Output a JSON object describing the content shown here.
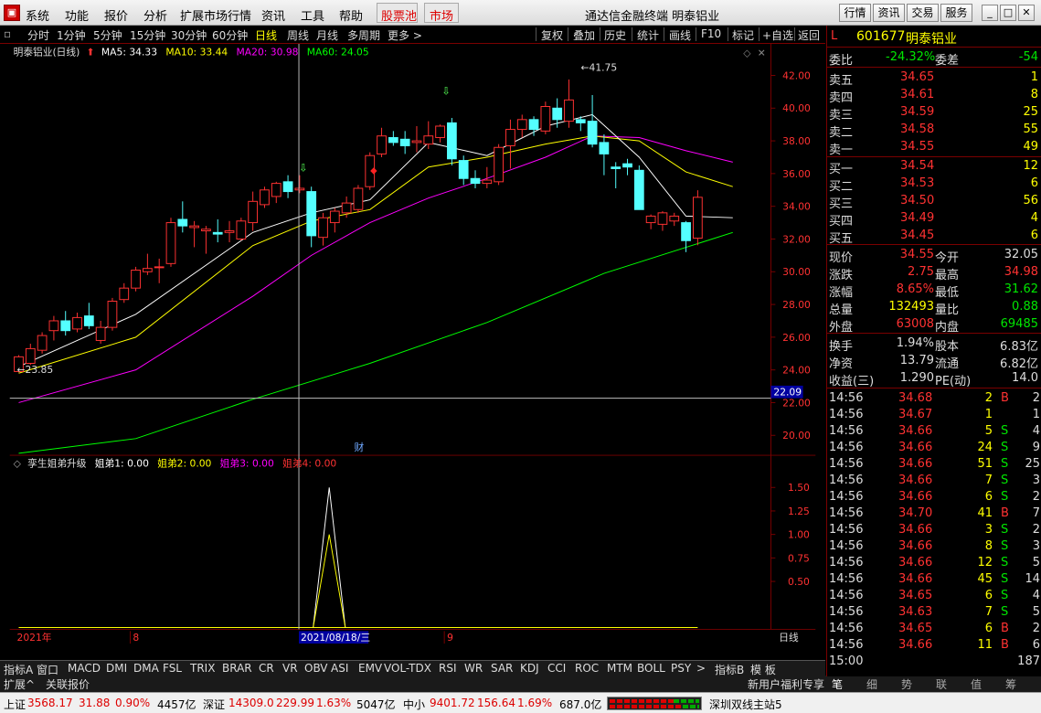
{
  "menubar": {
    "items": [
      "系统",
      "功能",
      "报价",
      "分析",
      "扩展市场行情",
      "资讯",
      "工具",
      "帮助"
    ],
    "red_items": [
      "股票池",
      "市场"
    ],
    "title": "通达信金融终端  明泰铝业",
    "right_buttons": [
      "行情",
      "资讯",
      "交易",
      "服务"
    ]
  },
  "toolbar": {
    "periods": [
      "分时",
      "1分钟",
      "5分钟",
      "15分钟",
      "30分钟",
      "60分钟",
      "日线",
      "周线",
      "月线",
      "多周期",
      "更多 >"
    ],
    "active": "日线",
    "actions": [
      "复权",
      "叠加",
      "历史",
      "统计",
      "画线",
      "F10",
      "标记",
      "+自选",
      "返回"
    ]
  },
  "chart": {
    "legend": {
      "name": "明泰铝业(日线)",
      "ma5": "MA5: 34.33",
      "ma10": "MA10: 33.44",
      "ma20": "MA20: 30.98",
      "ma60": "MA60: 24.05"
    },
    "high_label": "41.75",
    "low_label": "23.85",
    "crosshair_price": "22.09",
    "fin_marker": "财",
    "yticks": [
      "42.00",
      "40.00",
      "38.00",
      "36.00",
      "34.00",
      "32.00",
      "30.00",
      "28.00",
      "26.00",
      "24.00",
      "22.00",
      "20.00"
    ],
    "indicator_legend": {
      "name": "孪生姐弟升级",
      "s1": "姐弟1: 0.00",
      "s2": "姐弟2: 0.00",
      "s3": "姐弟3: 0.00",
      "s4": "姐弟4: 0.00"
    },
    "indicator_yticks": [
      "1.50",
      "1.00",
      "0.50"
    ],
    "indicator_extra_ticks": [
      "1.25",
      "0.75"
    ],
    "xaxis": {
      "year": "2021年",
      "m8": "8",
      "date": "2021/08/18/三",
      "m9": "9",
      "period": "日线"
    },
    "colors": {
      "up": "#ff3232",
      "down": "#54ffff",
      "ma5": "#ffffff",
      "ma10": "#ffff00",
      "ma20": "#ff00ff",
      "ma60": "#00ff00"
    }
  },
  "bottom_tabs": [
    "指标A",
    "窗口",
    "MACD",
    "DMI",
    "DMA",
    "FSL",
    "TRIX",
    "BRAR",
    "CR",
    "VR",
    "OBV",
    "ASI",
    "EMV",
    "VOL-TDX",
    "RSI",
    "WR",
    "SAR",
    "KDJ",
    "CCI",
    "ROC",
    "MTM",
    "BOLL",
    "PSY",
    ">",
    "指标B",
    "模 板"
  ],
  "ext_row": {
    "left": [
      "扩展^",
      "关联报价"
    ],
    "right": "新用户福利专享"
  },
  "right_tabs": [
    "笔",
    "细",
    "势",
    "联",
    "值",
    "筹"
  ],
  "quote": {
    "code": "601677",
    "name": "明泰铝业",
    "flag": "L",
    "weibi_label": "委比",
    "weibi": "-24.32%",
    "weicha_label": "委差",
    "weicha": "-54",
    "asks": [
      {
        "label": "卖五",
        "price": "34.65",
        "vol": "1"
      },
      {
        "label": "卖四",
        "price": "34.61",
        "vol": "8"
      },
      {
        "label": "卖三",
        "price": "34.59",
        "vol": "25"
      },
      {
        "label": "卖二",
        "price": "34.58",
        "vol": "55"
      },
      {
        "label": "卖一",
        "price": "34.55",
        "vol": "49"
      }
    ],
    "bids": [
      {
        "label": "买一",
        "price": "34.54",
        "vol": "12"
      },
      {
        "label": "买二",
        "price": "34.53",
        "vol": "6"
      },
      {
        "label": "买三",
        "price": "34.50",
        "vol": "56"
      },
      {
        "label": "买四",
        "price": "34.49",
        "vol": "4"
      },
      {
        "label": "买五",
        "price": "34.45",
        "vol": "6"
      }
    ],
    "stats": [
      {
        "l1": "现价",
        "v1": "34.55",
        "c1": "up",
        "l2": "今开",
        "v2": "32.05",
        "c2": "wh"
      },
      {
        "l1": "涨跌",
        "v1": "2.75",
        "c1": "up",
        "l2": "最高",
        "v2": "34.98",
        "c2": "up"
      },
      {
        "l1": "涨幅",
        "v1": "8.65%",
        "c1": "up",
        "l2": "最低",
        "v2": "31.62",
        "c2": "dn"
      },
      {
        "l1": "总量",
        "v1": "132493",
        "c1": "yl",
        "l2": "量比",
        "v2": "0.88",
        "c2": "dn"
      },
      {
        "l1": "外盘",
        "v1": "63008",
        "c1": "up",
        "l2": "内盘",
        "v2": "69485",
        "c2": "dn"
      }
    ],
    "stats2": [
      {
        "l1": "换手",
        "v1": "1.94%",
        "l2": "股本",
        "v2": "6.83亿"
      },
      {
        "l1": "净资",
        "v1": "13.79",
        "l2": "流通",
        "v2": "6.82亿"
      },
      {
        "l1": "收益(三)",
        "v1": "1.290",
        "l2": "PE(动)",
        "v2": "14.0"
      }
    ],
    "ticks": [
      {
        "t": "14:56",
        "p": "34.68",
        "v": "2",
        "bs": "B",
        "n": "2"
      },
      {
        "t": "14:56",
        "p": "34.67",
        "v": "1",
        "bs": "",
        "n": "1"
      },
      {
        "t": "14:56",
        "p": "34.66",
        "v": "5",
        "bs": "S",
        "n": "4"
      },
      {
        "t": "14:56",
        "p": "34.66",
        "v": "24",
        "bs": "S",
        "n": "9"
      },
      {
        "t": "14:56",
        "p": "34.66",
        "v": "51",
        "bs": "S",
        "n": "25"
      },
      {
        "t": "14:56",
        "p": "34.66",
        "v": "7",
        "bs": "S",
        "n": "3"
      },
      {
        "t": "14:56",
        "p": "34.66",
        "v": "6",
        "bs": "S",
        "n": "2"
      },
      {
        "t": "14:56",
        "p": "34.70",
        "v": "41",
        "bs": "B",
        "n": "7"
      },
      {
        "t": "14:56",
        "p": "34.66",
        "v": "3",
        "bs": "S",
        "n": "2"
      },
      {
        "t": "14:56",
        "p": "34.66",
        "v": "8",
        "bs": "S",
        "n": "3"
      },
      {
        "t": "14:56",
        "p": "34.66",
        "v": "12",
        "bs": "S",
        "n": "5"
      },
      {
        "t": "14:56",
        "p": "34.66",
        "v": "45",
        "bs": "S",
        "n": "14"
      },
      {
        "t": "14:56",
        "p": "34.65",
        "v": "6",
        "bs": "S",
        "n": "4"
      },
      {
        "t": "14:56",
        "p": "34.63",
        "v": "7",
        "bs": "S",
        "n": "5"
      },
      {
        "t": "14:56",
        "p": "34.65",
        "v": "6",
        "bs": "B",
        "n": "2"
      },
      {
        "t": "14:56",
        "p": "34.66",
        "v": "11",
        "bs": "B",
        "n": "6"
      },
      {
        "t": "15:00",
        "p": "",
        "v": "",
        "bs": "",
        "n": "187"
      }
    ]
  },
  "statusbar": {
    "sh_label": "上证",
    "sh_val": "3568.17",
    "sh_chg": "31.88",
    "sh_pct": "0.90%",
    "sh_amt": "4457亿",
    "sz_label": "深证",
    "sz_val": "14309.0",
    "sz_chg": "229.99",
    "sz_pct": "1.63%",
    "sz_amt": "5047亿",
    "zx_label": "中小",
    "zx_val": "9401.72",
    "zx_chg": "156.64",
    "zx_pct": "1.69%",
    "zx_amt": "687.0亿",
    "server": "深圳双线主站5"
  },
  "chart_data": {
    "type": "candlestick",
    "title": "明泰铝业(日线)",
    "ylim": [
      19,
      43
    ],
    "candles": [
      {
        "o": 23.9,
        "h": 24.9,
        "l": 23.85,
        "c": 24.8
      },
      {
        "o": 24.4,
        "h": 25.6,
        "l": 24.3,
        "c": 25.3
      },
      {
        "o": 25.2,
        "h": 26.3,
        "l": 25.0,
        "c": 26.1
      },
      {
        "o": 26.4,
        "h": 27.3,
        "l": 25.8,
        "c": 27.0
      },
      {
        "o": 27.0,
        "h": 27.6,
        "l": 26.1,
        "c": 26.4
      },
      {
        "o": 26.5,
        "h": 27.5,
        "l": 26.3,
        "c": 27.2
      },
      {
        "o": 27.3,
        "h": 28.1,
        "l": 26.5,
        "c": 26.7
      },
      {
        "o": 25.8,
        "h": 27.0,
        "l": 25.6,
        "c": 26.6
      },
      {
        "o": 26.6,
        "h": 28.4,
        "l": 26.4,
        "c": 28.2
      },
      {
        "o": 28.3,
        "h": 29.3,
        "l": 28.1,
        "c": 29.0
      },
      {
        "o": 29.0,
        "h": 30.3,
        "l": 28.8,
        "c": 30.1
      },
      {
        "o": 30.0,
        "h": 31.1,
        "l": 29.8,
        "c": 30.2
      },
      {
        "o": 30.3,
        "h": 30.8,
        "l": 29.3,
        "c": 30.3
      },
      {
        "o": 30.5,
        "h": 33.3,
        "l": 30.3,
        "c": 33.0
      },
      {
        "o": 33.2,
        "h": 34.3,
        "l": 32.4,
        "c": 32.8
      },
      {
        "o": 32.7,
        "h": 33.1,
        "l": 31.5,
        "c": 32.8
      },
      {
        "o": 32.5,
        "h": 32.8,
        "l": 31.1,
        "c": 32.6
      },
      {
        "o": 32.4,
        "h": 33.2,
        "l": 31.8,
        "c": 32.3
      },
      {
        "o": 32.4,
        "h": 33.1,
        "l": 31.8,
        "c": 32.5
      },
      {
        "o": 32.0,
        "h": 33.3,
        "l": 31.9,
        "c": 33.1
      },
      {
        "o": 33.0,
        "h": 34.9,
        "l": 32.5,
        "c": 34.3
      },
      {
        "o": 34.1,
        "h": 35.2,
        "l": 33.9,
        "c": 35.0
      },
      {
        "o": 34.6,
        "h": 35.5,
        "l": 34.2,
        "c": 35.4
      },
      {
        "o": 35.5,
        "h": 35.9,
        "l": 34.5,
        "c": 34.9
      },
      {
        "o": 35.0,
        "h": 35.9,
        "l": 34.8,
        "c": 35.1
      },
      {
        "o": 34.9,
        "h": 35.2,
        "l": 31.5,
        "c": 32.2
      },
      {
        "o": 32.1,
        "h": 33.6,
        "l": 31.6,
        "c": 33.3
      },
      {
        "o": 33.0,
        "h": 33.9,
        "l": 32.4,
        "c": 33.7
      },
      {
        "o": 33.6,
        "h": 34.6,
        "l": 33.3,
        "c": 34.2
      },
      {
        "o": 33.8,
        "h": 35.3,
        "l": 33.6,
        "c": 35.1
      },
      {
        "o": 35.2,
        "h": 37.3,
        "l": 35.0,
        "c": 37.1
      },
      {
        "o": 37.2,
        "h": 38.8,
        "l": 37.0,
        "c": 38.3
      },
      {
        "o": 38.2,
        "h": 38.6,
        "l": 37.7,
        "c": 37.9
      },
      {
        "o": 38.1,
        "h": 38.6,
        "l": 37.2,
        "c": 37.7
      },
      {
        "o": 37.9,
        "h": 38.9,
        "l": 37.3,
        "c": 38.0
      },
      {
        "o": 37.8,
        "h": 39.2,
        "l": 37.5,
        "c": 38.3
      },
      {
        "o": 38.2,
        "h": 39.0,
        "l": 37.9,
        "c": 38.9
      },
      {
        "o": 39.1,
        "h": 39.4,
        "l": 36.5,
        "c": 36.9
      },
      {
        "o": 36.8,
        "h": 37.1,
        "l": 35.3,
        "c": 35.7
      },
      {
        "o": 35.7,
        "h": 36.2,
        "l": 35.1,
        "c": 35.4
      },
      {
        "o": 35.4,
        "h": 36.4,
        "l": 35.1,
        "c": 35.6
      },
      {
        "o": 35.5,
        "h": 37.8,
        "l": 35.3,
        "c": 37.6
      },
      {
        "o": 37.7,
        "h": 39.3,
        "l": 36.3,
        "c": 38.7
      },
      {
        "o": 38.7,
        "h": 39.6,
        "l": 38.2,
        "c": 39.3
      },
      {
        "o": 39.3,
        "h": 39.5,
        "l": 38.3,
        "c": 38.7
      },
      {
        "o": 38.6,
        "h": 40.4,
        "l": 38.4,
        "c": 40.1
      },
      {
        "o": 40.0,
        "h": 40.6,
        "l": 38.8,
        "c": 39.3
      },
      {
        "o": 39.2,
        "h": 41.75,
        "l": 38.8,
        "c": 40.5
      },
      {
        "o": 39.3,
        "h": 39.5,
        "l": 38.6,
        "c": 39.1
      },
      {
        "o": 39.2,
        "h": 40.8,
        "l": 37.6,
        "c": 37.8
      },
      {
        "o": 37.9,
        "h": 38.4,
        "l": 35.9,
        "c": 37.2
      },
      {
        "o": 36.4,
        "h": 36.7,
        "l": 35.1,
        "c": 36.3
      },
      {
        "o": 36.6,
        "h": 36.9,
        "l": 35.9,
        "c": 36.4
      },
      {
        "o": 36.2,
        "h": 36.5,
        "l": 33.8,
        "c": 33.8
      },
      {
        "o": 33.0,
        "h": 33.5,
        "l": 32.6,
        "c": 33.4
      },
      {
        "o": 32.9,
        "h": 33.7,
        "l": 32.5,
        "c": 33.6
      },
      {
        "o": 33.1,
        "h": 33.6,
        "l": 32.8,
        "c": 33.4
      },
      {
        "o": 33.0,
        "h": 33.1,
        "l": 31.2,
        "c": 31.9
      },
      {
        "o": 32.05,
        "h": 34.98,
        "l": 31.62,
        "c": 34.55
      }
    ],
    "ma5": [
      [
        0,
        24.2
      ],
      [
        10,
        27.4
      ],
      [
        20,
        32.4
      ],
      [
        25,
        33.6
      ],
      [
        30,
        34.4
      ],
      [
        35,
        37.9
      ],
      [
        40,
        37.1
      ],
      [
        45,
        38.9
      ],
      [
        49,
        39.6
      ],
      [
        53,
        37.0
      ],
      [
        57,
        33.4
      ],
      [
        61,
        33.3
      ]
    ],
    "ma10": [
      [
        0,
        23.8
      ],
      [
        10,
        26.0
      ],
      [
        20,
        31.6
      ],
      [
        25,
        33.1
      ],
      [
        30,
        33.8
      ],
      [
        35,
        36.4
      ],
      [
        40,
        37.0
      ],
      [
        45,
        37.8
      ],
      [
        49,
        38.3
      ],
      [
        53,
        38.0
      ],
      [
        57,
        36.1
      ],
      [
        61,
        35.2
      ]
    ],
    "ma20": [
      [
        0,
        22.0
      ],
      [
        10,
        24.0
      ],
      [
        20,
        28.5
      ],
      [
        25,
        31.0
      ],
      [
        30,
        33.0
      ],
      [
        35,
        34.5
      ],
      [
        40,
        35.7
      ],
      [
        45,
        37.0
      ],
      [
        49,
        38.3
      ],
      [
        53,
        38.2
      ],
      [
        57,
        37.4
      ],
      [
        61,
        36.7
      ]
    ],
    "ma60": [
      [
        0,
        18.9
      ],
      [
        10,
        19.8
      ],
      [
        20,
        22.2
      ],
      [
        30,
        24.4
      ],
      [
        40,
        26.9
      ],
      [
        50,
        29.9
      ],
      [
        61,
        32.4
      ]
    ],
    "indicator": {
      "series": [
        {
          "name": "姐弟1",
          "peak": 1.5
        },
        {
          "name": "姐弟2",
          "peak": 1.0
        }
      ],
      "signal_index": 25,
      "ylim": [
        0,
        1.7
      ]
    }
  }
}
